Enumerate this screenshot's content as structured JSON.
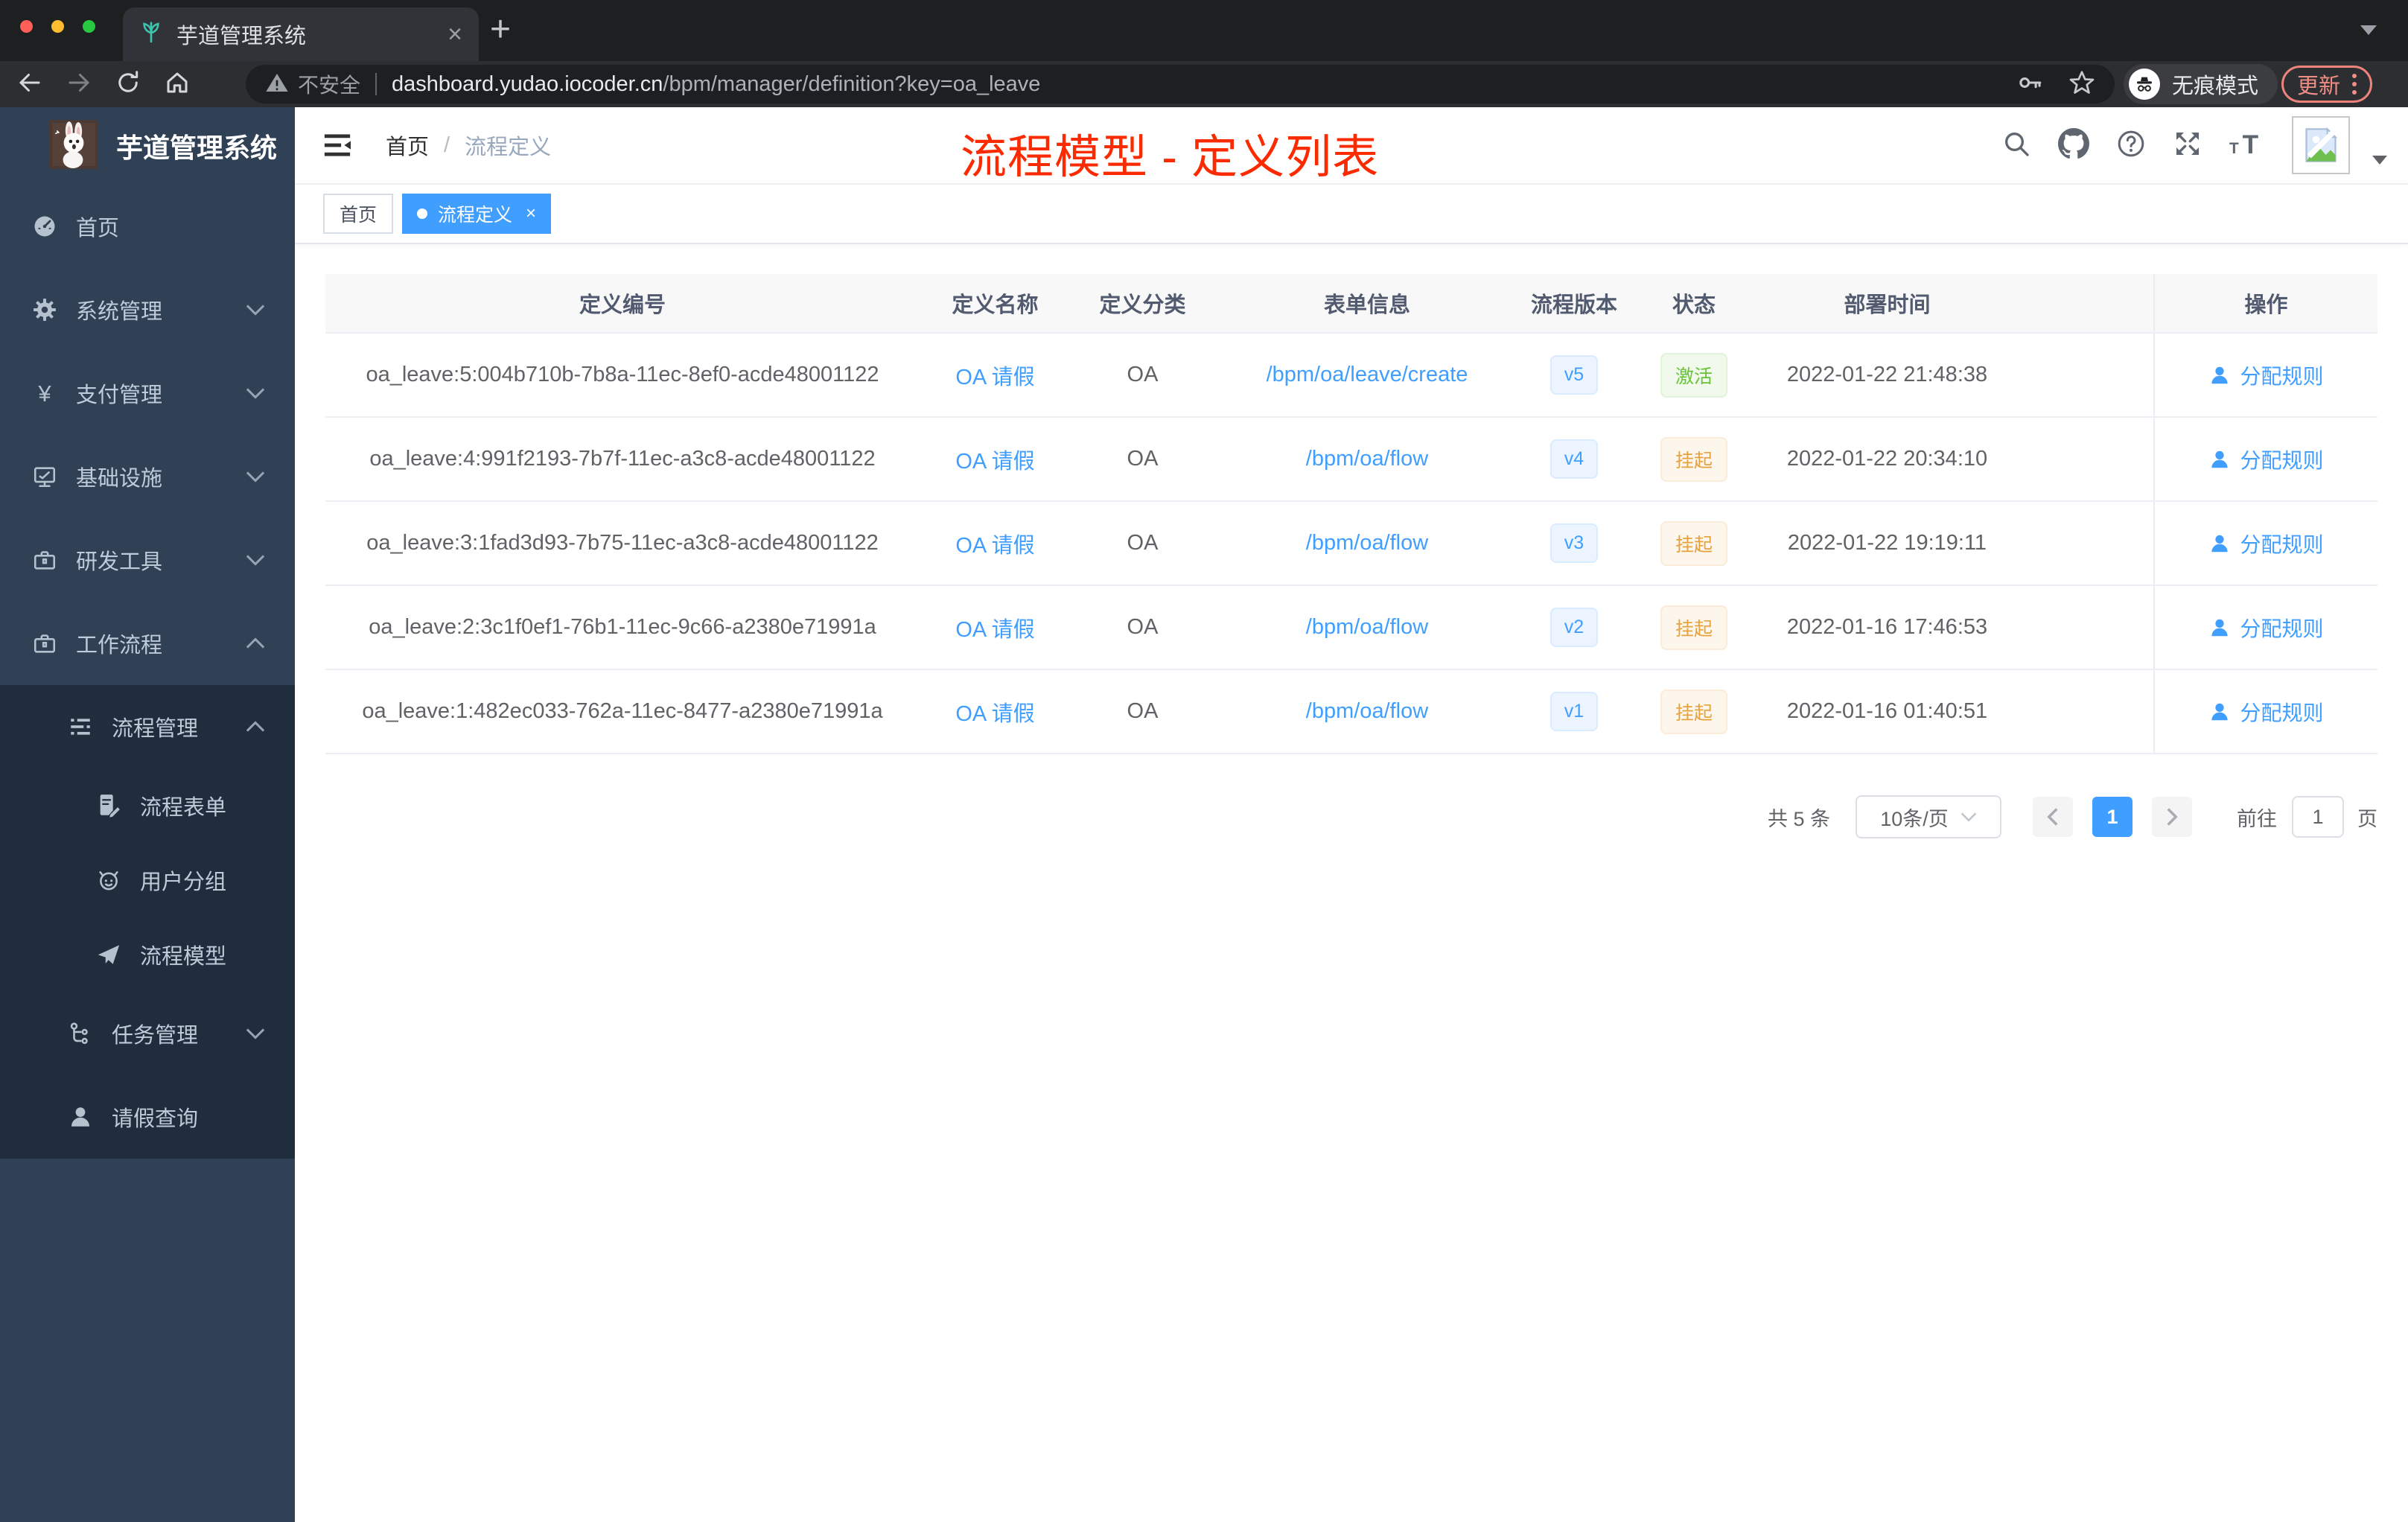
{
  "browser": {
    "tab_title": "芋道管理系统",
    "new_tab": "+",
    "close_tab": "×",
    "security_label": "不安全",
    "url_domain": "dashboard.yudao.iocoder.cn",
    "url_path": "/bpm/manager/definition?key=oa_leave",
    "incognito_label": "无痕模式",
    "update_label": "更新"
  },
  "sidebar": {
    "logo_title": "芋道管理系统",
    "items": [
      {
        "label": "首页"
      },
      {
        "label": "系统管理"
      },
      {
        "label": "支付管理"
      },
      {
        "label": "基础设施"
      },
      {
        "label": "研发工具"
      },
      {
        "label": "工作流程"
      },
      {
        "label": "流程管理"
      },
      {
        "label": "流程表单"
      },
      {
        "label": "用户分组"
      },
      {
        "label": "流程模型"
      },
      {
        "label": "任务管理"
      },
      {
        "label": "请假查询"
      }
    ]
  },
  "header": {
    "breadcrumb_home": "首页",
    "breadcrumb_sep": "/",
    "breadcrumb_current": "流程定义",
    "annotation": "流程模型 - 定义列表"
  },
  "tags": {
    "home": "首页",
    "active": "流程定义",
    "close": "×"
  },
  "table": {
    "columns": [
      "定义编号",
      "定义名称",
      "定义分类",
      "表单信息",
      "流程版本",
      "状态",
      "部署时间",
      "操作"
    ],
    "rows": [
      {
        "id": "oa_leave:5:004b710b-7b8a-11ec-8ef0-acde48001122",
        "name": "OA 请假",
        "category": "OA",
        "form": "/bpm/oa/leave/create",
        "version": "v5",
        "status": "激活",
        "status_type": "success",
        "time": "2022-01-22 21:48:38",
        "action": "分配规则"
      },
      {
        "id": "oa_leave:4:991f2193-7b7f-11ec-a3c8-acde48001122",
        "name": "OA 请假",
        "category": "OA",
        "form": "/bpm/oa/flow",
        "version": "v4",
        "status": "挂起",
        "status_type": "warning",
        "time": "2022-01-22 20:34:10",
        "action": "分配规则"
      },
      {
        "id": "oa_leave:3:1fad3d93-7b75-11ec-a3c8-acde48001122",
        "name": "OA 请假",
        "category": "OA",
        "form": "/bpm/oa/flow",
        "version": "v3",
        "status": "挂起",
        "status_type": "warning",
        "time": "2022-01-22 19:19:11",
        "action": "分配规则"
      },
      {
        "id": "oa_leave:2:3c1f0ef1-76b1-11ec-9c66-a2380e71991a",
        "name": "OA 请假",
        "category": "OA",
        "form": "/bpm/oa/flow",
        "version": "v2",
        "status": "挂起",
        "status_type": "warning",
        "time": "2022-01-16 17:46:53",
        "action": "分配规则"
      },
      {
        "id": "oa_leave:1:482ec033-762a-11ec-8477-a2380e71991a",
        "name": "OA 请假",
        "category": "OA",
        "form": "/bpm/oa/flow",
        "version": "v1",
        "status": "挂起",
        "status_type": "warning",
        "time": "2022-01-16 01:40:51",
        "action": "分配规则"
      }
    ]
  },
  "pagination": {
    "total": "共 5 条",
    "page_size": "10条/页",
    "page": "1",
    "goto_label": "前往",
    "goto_value": "1",
    "unit_label": "页"
  },
  "colors": {
    "accent": "#409eff",
    "annotation_red": "#fb2b01",
    "success_green": "#67c23a",
    "warning_orange": "#e6a23c",
    "sidebar_bg": "#304156",
    "submenu_bg": "#1f2d3d"
  }
}
